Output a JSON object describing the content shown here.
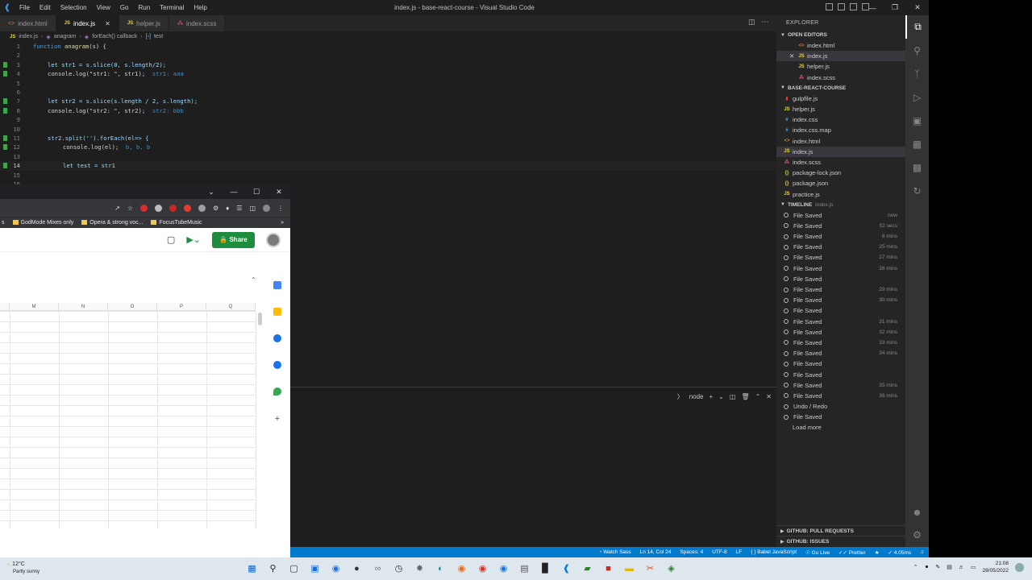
{
  "vscode": {
    "menu": [
      "File",
      "Edit",
      "Selection",
      "View",
      "Go",
      "Run",
      "Terminal",
      "Help"
    ],
    "window_title": "index.js - base-react-course - Visual Studio Code",
    "tabs": [
      {
        "label": "index.html",
        "icon": "html-icon"
      },
      {
        "label": "index.js",
        "icon": "js-icon",
        "active": true
      },
      {
        "label": "helper.js",
        "icon": "js-icon"
      },
      {
        "label": "index.scss",
        "icon": "scss-icon"
      }
    ],
    "breadcrumb": [
      "index.js",
      "anagram",
      "forEach() callback",
      "test"
    ],
    "line_numbers": [
      "1",
      "2",
      "3",
      "4",
      "5",
      "6",
      "7",
      "8",
      "9",
      "10",
      "11",
      "12",
      "13",
      "14",
      "15",
      "16"
    ],
    "code": {
      "l1_kw": "function",
      "l1_fn": "anagram",
      "l1_rest": "(s) {",
      "l3": "let str1 = s.slice(0, s.length/2);",
      "l4": "console.log(\"str1: \", str1);",
      "l4_hint": "str1: aaa",
      "l7": "let str2 = s.slice(s.length / 2, s.length);",
      "l8": "console.log(\"str2: \", str2);",
      "l8_hint": "str2: bbb",
      "l11": "str2.split('').forEach(el=> {",
      "l12": "console.log(el);",
      "l12_hint": "b, b, b",
      "l14": "let test = str1"
    },
    "panel": {
      "terminal_name": "node"
    },
    "explorer": {
      "title": "EXPLORER",
      "open_editors_label": "OPEN EDITORS",
      "open_editors": [
        "index.html",
        "index.js",
        "helper.js",
        "index.scss"
      ],
      "project_label": "BASE-REACT-COURSE",
      "files": [
        {
          "name": "gulpfile.js",
          "icon": "gulp-icon"
        },
        {
          "name": "helper.js",
          "icon": "js-icon"
        },
        {
          "name": "index.css",
          "icon": "css-icon"
        },
        {
          "name": "index.css.map",
          "icon": "css-icon"
        },
        {
          "name": "index.html",
          "icon": "html-icon"
        },
        {
          "name": "index.js",
          "icon": "js-icon",
          "selected": true
        },
        {
          "name": "index.scss",
          "icon": "scss-icon"
        },
        {
          "name": "package-lock.json",
          "icon": "json-icon"
        },
        {
          "name": "package.json",
          "icon": "json-icon"
        },
        {
          "name": "practice.js",
          "icon": "js-icon"
        }
      ],
      "timeline_label": "TIMELINE",
      "timeline_file": "index.js",
      "timeline": [
        {
          "label": "File Saved",
          "age": "now"
        },
        {
          "label": "File Saved",
          "age": "52 secs"
        },
        {
          "label": "File Saved",
          "age": "8 mins"
        },
        {
          "label": "File Saved",
          "age": "25 mins"
        },
        {
          "label": "File Saved",
          "age": "27 mins"
        },
        {
          "label": "File Saved",
          "age": "28 mins"
        },
        {
          "label": "File Saved",
          "age": ""
        },
        {
          "label": "File Saved",
          "age": "29 mins"
        },
        {
          "label": "File Saved",
          "age": "30 mins"
        },
        {
          "label": "File Saved",
          "age": ""
        },
        {
          "label": "File Saved",
          "age": "31 mins"
        },
        {
          "label": "File Saved",
          "age": "32 mins"
        },
        {
          "label": "File Saved",
          "age": "33 mins"
        },
        {
          "label": "File Saved",
          "age": "34 mins"
        },
        {
          "label": "File Saved",
          "age": ""
        },
        {
          "label": "File Saved",
          "age": ""
        },
        {
          "label": "File Saved",
          "age": "35 mins"
        },
        {
          "label": "File Saved",
          "age": "36 mins"
        },
        {
          "label": "Undo / Redo",
          "age": ""
        },
        {
          "label": "File Saved",
          "age": ""
        }
      ],
      "load_more": "Load more",
      "pull_requests_label": "GITHUB: PULL REQUESTS",
      "issues_label": "GITHUB: ISSUES"
    },
    "statusbar": {
      "watch_sass": "Watch Sass",
      "cursor": "Ln 14, Col 24",
      "spaces": "Spaces: 4",
      "encoding": "UTF-8",
      "eol": "LF",
      "language": "Babel JavaScript",
      "go_live": "Go Live",
      "prettier": "Prettier",
      "timing": "4.05ms"
    }
  },
  "chrome": {
    "bookmarks": [
      "GodMode Mixes only",
      "Opera & strong voc...",
      "FocusTubeMusic"
    ],
    "share_label": "Share",
    "columns": [
      "M",
      "N",
      "O",
      "P",
      "Q"
    ]
  },
  "taskbar": {
    "temperature": "12°C",
    "weather": "Partly sunny",
    "time": "21:08",
    "date": "28/05/2022"
  },
  "colors": {
    "editor_bg": "#1e1e1e",
    "statusbar": "#007acc",
    "share_button": "#1e8e3e"
  }
}
